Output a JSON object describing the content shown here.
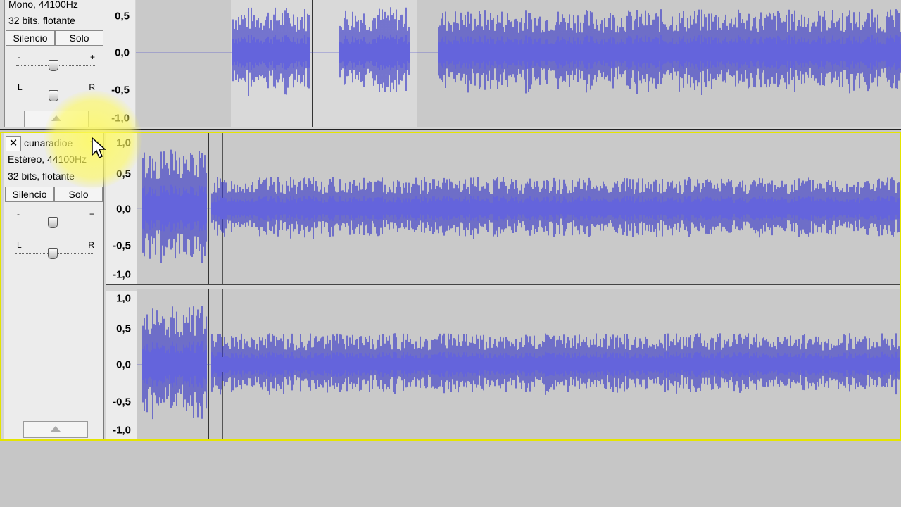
{
  "track1": {
    "format": "Mono, 44100Hz",
    "bitdepth": "32 bits, flotante",
    "mute_label": "Silencio",
    "solo_label": "Solo",
    "gain_minus": "-",
    "gain_plus": "+",
    "pan_left": "L",
    "pan_right": "R",
    "ruler": [
      "0,5",
      "0,0",
      "-0,5",
      "-1,0"
    ]
  },
  "track2": {
    "close_label": "✕",
    "name": "cunaradioe",
    "format": "Estéreo, 44100Hz",
    "bitdepth": "32 bits, flotante",
    "mute_label": "Silencio",
    "solo_label": "Solo",
    "gain_minus": "-",
    "gain_plus": "+",
    "pan_left": "L",
    "pan_right": "R",
    "ruler_top": [
      "1,0",
      "0,5",
      "0,0",
      "-0,5",
      "-1,0"
    ],
    "ruler_bottom": [
      "1,0",
      "0,5",
      "0,0",
      "-0,5",
      "-1,0"
    ]
  },
  "colors": {
    "waveform": "#3232c8",
    "waveform_rms": "#6464dc",
    "selection_border": "#e4e400"
  }
}
